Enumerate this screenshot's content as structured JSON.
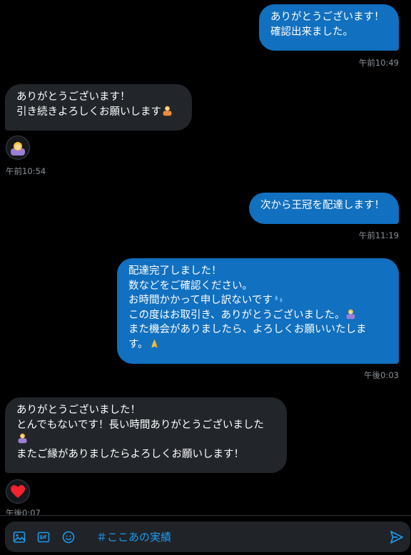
{
  "messages": [
    {
      "text": "ありがとうございます！\n確認出来ました。",
      "time": "午前10:49"
    },
    {
      "text": "ありがとうございます！\n引き続きよろしくお願いします",
      "time": "午前10:54"
    },
    {
      "text": "次から王冠を配達します！",
      "time": "午前11:19"
    },
    {
      "lines": [
        "配達完了しました！",
        "数などをご確認ください。",
        "お時間かかって申し訳ないです",
        "この度はお取引き、ありがとうございました。",
        "また機会がありましたら、よろしくお願いいたしま",
        "す。"
      ],
      "time": "午後0:03"
    },
    {
      "lines": [
        "ありがとうございました！",
        "とんでもないです！長い時間ありがとうございました",
        "",
        "またご縁がありましたらよろしくお願いします！"
      ],
      "time": "午後0:07"
    }
  ],
  "composer": {
    "draft": "＃ここあの実績",
    "icons": [
      "image-icon",
      "gif-icon",
      "emoji-icon",
      "send-icon"
    ]
  },
  "colors": {
    "outgoing_bubble": "#1170bf",
    "incoming_bubble": "#22262b",
    "accent": "#1d9bf0",
    "timestamp": "#8b9299",
    "background": "#000000"
  }
}
